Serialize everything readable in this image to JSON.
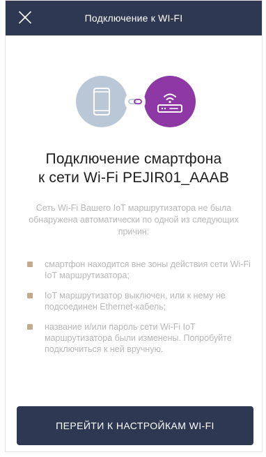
{
  "header": {
    "title": "Подключение к WI-FI",
    "close_icon": "close-icon"
  },
  "illustration": {
    "phone_icon": "smartphone-icon",
    "link_icon": "link-icon",
    "router_icon": "wifi-router-icon",
    "phone_circle_color": "#b9c7d6",
    "router_circle_color": "#8e38a6"
  },
  "heading": {
    "line1": "Подключение смартфона",
    "line2": "к сети Wi-Fi PEJIR01_AAAB"
  },
  "intro": "Сеть Wi-Fi Вашего IoT маршрутизатора не была обнаружена автоматически по одной из следующих причин:",
  "reasons": [
    {
      "text": "смартфон находится вне зоны действия сети Wi-Fi IoT маршрутизатора;"
    },
    {
      "text": "IoT маршрутизатор выключен, или к нему не подсоединен Ethernet-кабель;"
    },
    {
      "text": "название и/или пароль сети Wi-Fi IoT маршрутизатора были изменены. Попробуйте подключиться к ней вручную."
    }
  ],
  "cta": {
    "label": "ПЕРЕЙТИ К НАСТРОЙКАМ WI-FI"
  },
  "colors": {
    "header_bg": "#2f3853",
    "accent_purple": "#8e38a6",
    "bullet": "#c4ab8e",
    "muted_text": "#b7b7b7"
  }
}
